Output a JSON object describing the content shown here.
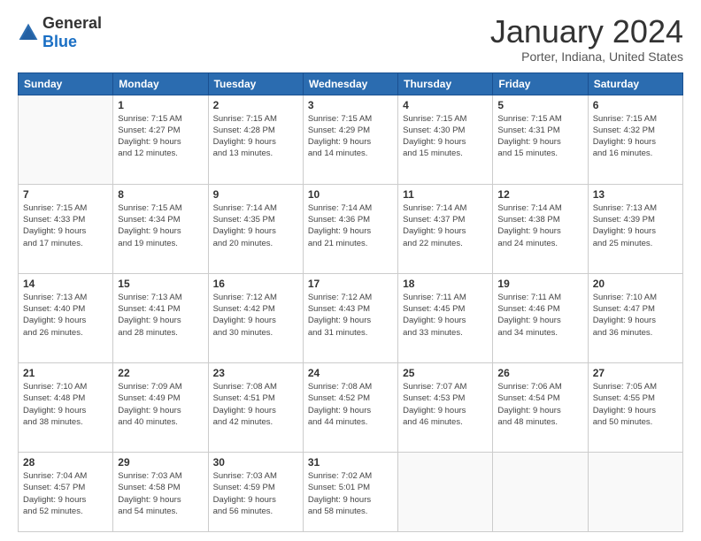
{
  "logo": {
    "general": "General",
    "blue": "Blue"
  },
  "title": "January 2024",
  "subtitle": "Porter, Indiana, United States",
  "days": [
    "Sunday",
    "Monday",
    "Tuesday",
    "Wednesday",
    "Thursday",
    "Friday",
    "Saturday"
  ],
  "weeks": [
    [
      {
        "num": "",
        "info": ""
      },
      {
        "num": "1",
        "info": "Sunrise: 7:15 AM\nSunset: 4:27 PM\nDaylight: 9 hours\nand 12 minutes."
      },
      {
        "num": "2",
        "info": "Sunrise: 7:15 AM\nSunset: 4:28 PM\nDaylight: 9 hours\nand 13 minutes."
      },
      {
        "num": "3",
        "info": "Sunrise: 7:15 AM\nSunset: 4:29 PM\nDaylight: 9 hours\nand 14 minutes."
      },
      {
        "num": "4",
        "info": "Sunrise: 7:15 AM\nSunset: 4:30 PM\nDaylight: 9 hours\nand 15 minutes."
      },
      {
        "num": "5",
        "info": "Sunrise: 7:15 AM\nSunset: 4:31 PM\nDaylight: 9 hours\nand 15 minutes."
      },
      {
        "num": "6",
        "info": "Sunrise: 7:15 AM\nSunset: 4:32 PM\nDaylight: 9 hours\nand 16 minutes."
      }
    ],
    [
      {
        "num": "7",
        "info": "Sunrise: 7:15 AM\nSunset: 4:33 PM\nDaylight: 9 hours\nand 17 minutes."
      },
      {
        "num": "8",
        "info": "Sunrise: 7:15 AM\nSunset: 4:34 PM\nDaylight: 9 hours\nand 19 minutes."
      },
      {
        "num": "9",
        "info": "Sunrise: 7:14 AM\nSunset: 4:35 PM\nDaylight: 9 hours\nand 20 minutes."
      },
      {
        "num": "10",
        "info": "Sunrise: 7:14 AM\nSunset: 4:36 PM\nDaylight: 9 hours\nand 21 minutes."
      },
      {
        "num": "11",
        "info": "Sunrise: 7:14 AM\nSunset: 4:37 PM\nDaylight: 9 hours\nand 22 minutes."
      },
      {
        "num": "12",
        "info": "Sunrise: 7:14 AM\nSunset: 4:38 PM\nDaylight: 9 hours\nand 24 minutes."
      },
      {
        "num": "13",
        "info": "Sunrise: 7:13 AM\nSunset: 4:39 PM\nDaylight: 9 hours\nand 25 minutes."
      }
    ],
    [
      {
        "num": "14",
        "info": "Sunrise: 7:13 AM\nSunset: 4:40 PM\nDaylight: 9 hours\nand 26 minutes."
      },
      {
        "num": "15",
        "info": "Sunrise: 7:13 AM\nSunset: 4:41 PM\nDaylight: 9 hours\nand 28 minutes."
      },
      {
        "num": "16",
        "info": "Sunrise: 7:12 AM\nSunset: 4:42 PM\nDaylight: 9 hours\nand 30 minutes."
      },
      {
        "num": "17",
        "info": "Sunrise: 7:12 AM\nSunset: 4:43 PM\nDaylight: 9 hours\nand 31 minutes."
      },
      {
        "num": "18",
        "info": "Sunrise: 7:11 AM\nSunset: 4:45 PM\nDaylight: 9 hours\nand 33 minutes."
      },
      {
        "num": "19",
        "info": "Sunrise: 7:11 AM\nSunset: 4:46 PM\nDaylight: 9 hours\nand 34 minutes."
      },
      {
        "num": "20",
        "info": "Sunrise: 7:10 AM\nSunset: 4:47 PM\nDaylight: 9 hours\nand 36 minutes."
      }
    ],
    [
      {
        "num": "21",
        "info": "Sunrise: 7:10 AM\nSunset: 4:48 PM\nDaylight: 9 hours\nand 38 minutes."
      },
      {
        "num": "22",
        "info": "Sunrise: 7:09 AM\nSunset: 4:49 PM\nDaylight: 9 hours\nand 40 minutes."
      },
      {
        "num": "23",
        "info": "Sunrise: 7:08 AM\nSunset: 4:51 PM\nDaylight: 9 hours\nand 42 minutes."
      },
      {
        "num": "24",
        "info": "Sunrise: 7:08 AM\nSunset: 4:52 PM\nDaylight: 9 hours\nand 44 minutes."
      },
      {
        "num": "25",
        "info": "Sunrise: 7:07 AM\nSunset: 4:53 PM\nDaylight: 9 hours\nand 46 minutes."
      },
      {
        "num": "26",
        "info": "Sunrise: 7:06 AM\nSunset: 4:54 PM\nDaylight: 9 hours\nand 48 minutes."
      },
      {
        "num": "27",
        "info": "Sunrise: 7:05 AM\nSunset: 4:55 PM\nDaylight: 9 hours\nand 50 minutes."
      }
    ],
    [
      {
        "num": "28",
        "info": "Sunrise: 7:04 AM\nSunset: 4:57 PM\nDaylight: 9 hours\nand 52 minutes."
      },
      {
        "num": "29",
        "info": "Sunrise: 7:03 AM\nSunset: 4:58 PM\nDaylight: 9 hours\nand 54 minutes."
      },
      {
        "num": "30",
        "info": "Sunrise: 7:03 AM\nSunset: 4:59 PM\nDaylight: 9 hours\nand 56 minutes."
      },
      {
        "num": "31",
        "info": "Sunrise: 7:02 AM\nSunset: 5:01 PM\nDaylight: 9 hours\nand 58 minutes."
      },
      {
        "num": "",
        "info": ""
      },
      {
        "num": "",
        "info": ""
      },
      {
        "num": "",
        "info": ""
      }
    ]
  ]
}
